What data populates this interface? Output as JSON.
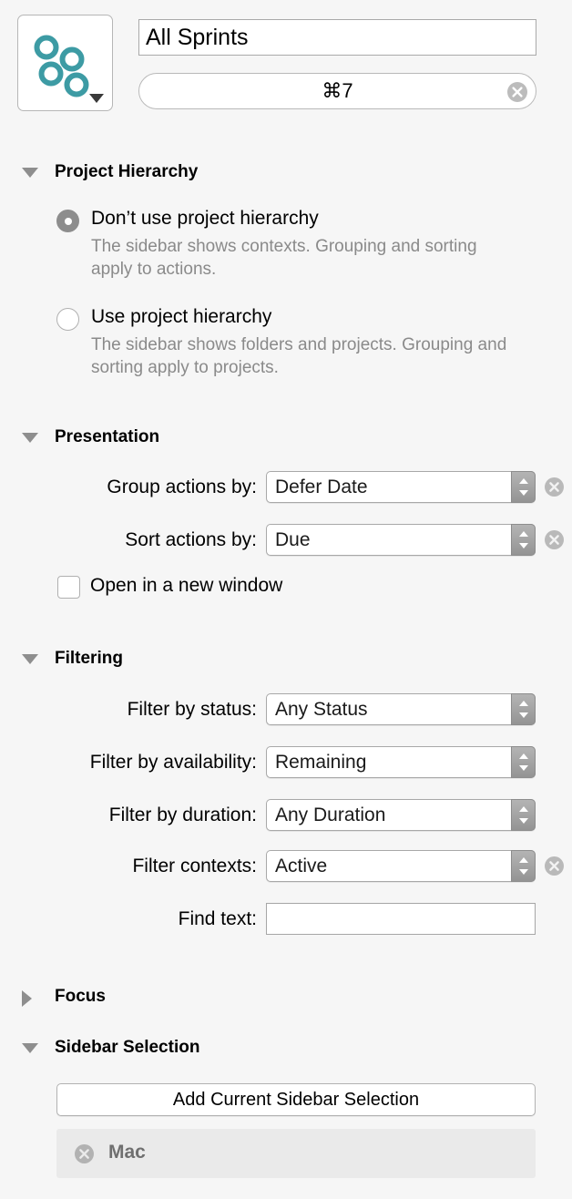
{
  "header": {
    "icon_name": "perspective-icon",
    "icon_color": "#3d9ba4",
    "dropdown_name": "icon-chooser-disclosure",
    "title_value": "All Sprints",
    "title_placeholder": "",
    "shortcut_value": "⌘7",
    "shortcut_clear_label": "clear-shortcut"
  },
  "sections": {
    "project_hierarchy": {
      "title": "Project Hierarchy",
      "expanded": true,
      "options": [
        {
          "label": "Don’t use project hierarchy",
          "help": "The sidebar shows contexts. Grouping and sorting apply to actions.",
          "selected": true
        },
        {
          "label": "Use project hierarchy",
          "help": "The sidebar shows folders and projects. Grouping and sorting apply to projects.",
          "selected": false
        }
      ]
    },
    "presentation": {
      "title": "Presentation",
      "expanded": true,
      "rows": [
        {
          "label": "Group actions by:",
          "value": "Defer Date",
          "has_clear": true
        },
        {
          "label": "Sort actions by:",
          "value": "Due",
          "has_clear": true
        }
      ],
      "checkbox": {
        "label": "Open in a new window",
        "checked": false
      }
    },
    "filtering": {
      "title": "Filtering",
      "expanded": true,
      "rows": [
        {
          "label": "Filter by status:",
          "value": "Any Status",
          "has_clear": false
        },
        {
          "label": "Filter by availability:",
          "value": "Remaining",
          "has_clear": false
        },
        {
          "label": "Filter by duration:",
          "value": "Any Duration",
          "has_clear": false
        },
        {
          "label": "Filter contexts:",
          "value": "Active",
          "has_clear": true
        }
      ],
      "find": {
        "label": "Find text:",
        "value": "",
        "placeholder": ""
      }
    },
    "focus": {
      "title": "Focus",
      "expanded": false
    },
    "sidebar_selection": {
      "title": "Sidebar Selection",
      "expanded": true,
      "add_button": "Add Current Sidebar Selection",
      "tokens": [
        {
          "label": "Mac"
        }
      ]
    }
  },
  "colors": {
    "background": "#f6f6f6",
    "accent_teal": "#3d9ba4",
    "help_text": "#8a8a8a",
    "twisty": "#8e8e8e",
    "token_background": "#eaeaea",
    "token_text": "#6f6f6f"
  }
}
